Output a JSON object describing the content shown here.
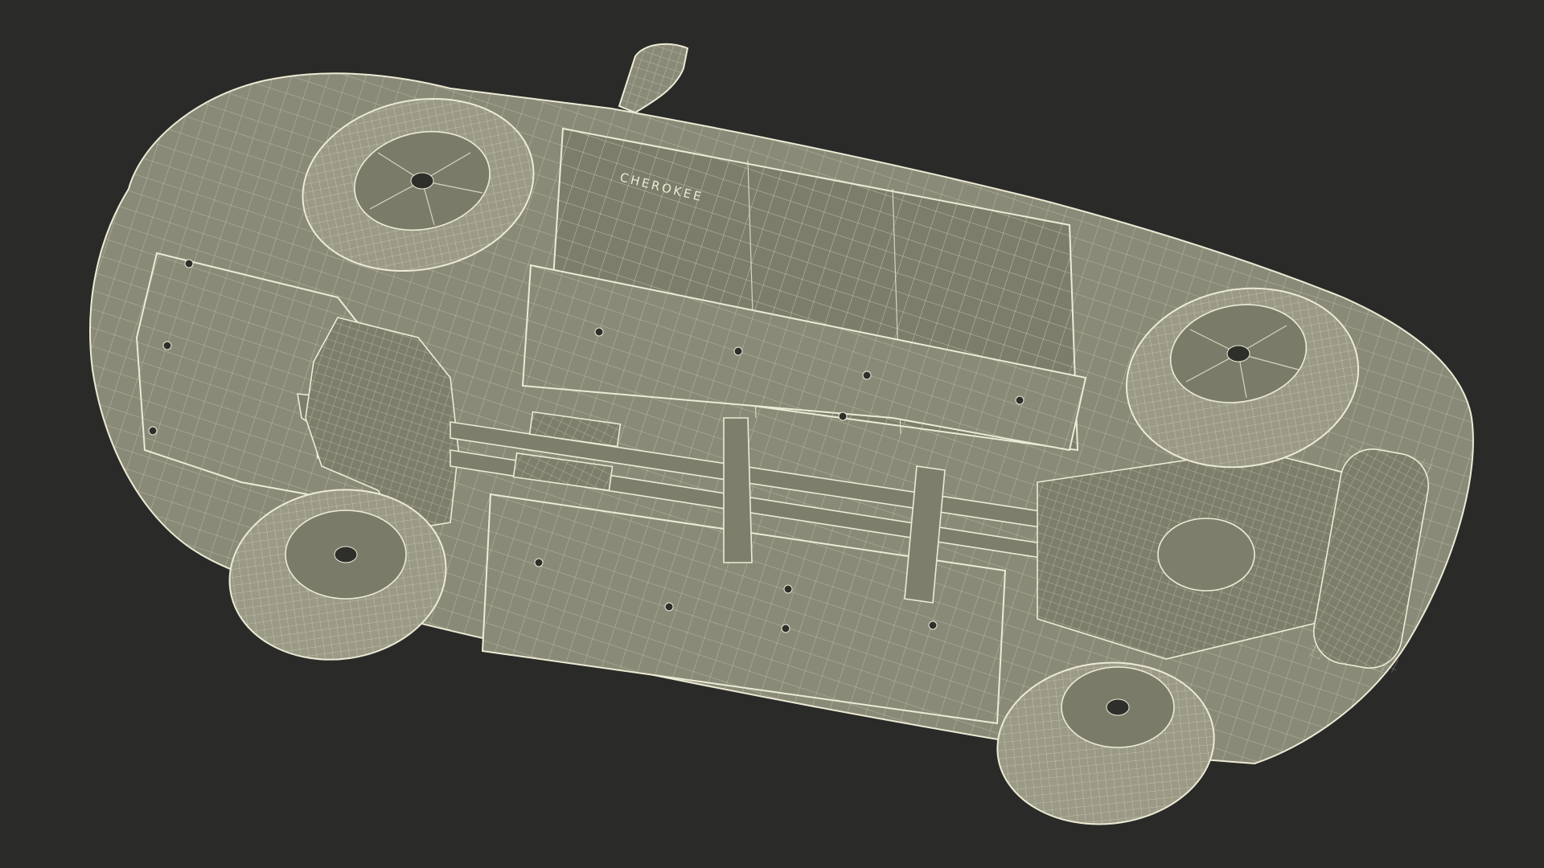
{
  "image": {
    "background_color": "#2a2a28",
    "model_color": "#8a8a78",
    "wire_color": "#e8e4cc"
  },
  "car": {
    "badge_text": "CHEROKEE"
  }
}
